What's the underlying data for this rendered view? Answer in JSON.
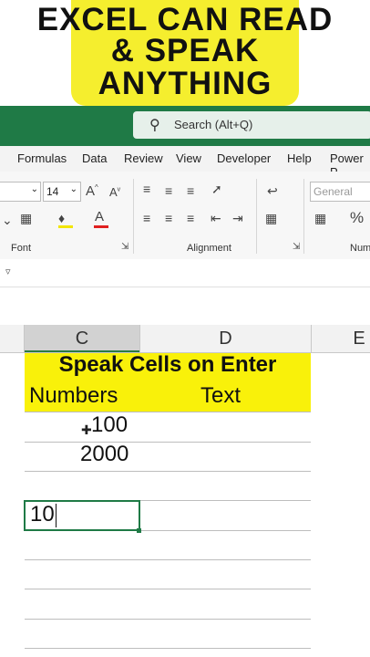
{
  "banner": {
    "line1": "EXCEL CAN READ",
    "line2": "& SPEAK",
    "line3": "ANYTHING"
  },
  "search": {
    "placeholder": "Search (Alt+Q)"
  },
  "menu": [
    "Formulas",
    "Data",
    "Review",
    "View",
    "Developer",
    "Help",
    "Power P"
  ],
  "ribbon": {
    "font_size": "14",
    "number_format": "General",
    "groups": {
      "font": "Font",
      "alignment": "Alignment",
      "number": "Num"
    }
  },
  "columns": [
    "C",
    "D",
    "E"
  ],
  "sheet": {
    "heading": "Speak Cells on Enter",
    "col_c_header": "Numbers",
    "col_d_header": "Text",
    "rows": [
      "100",
      "2000"
    ],
    "active_value": "10"
  },
  "colors": {
    "excel_green": "#1f7a46",
    "highlight_yellow": "#f9f10a",
    "banner_yellow": "#f5ee2e"
  }
}
